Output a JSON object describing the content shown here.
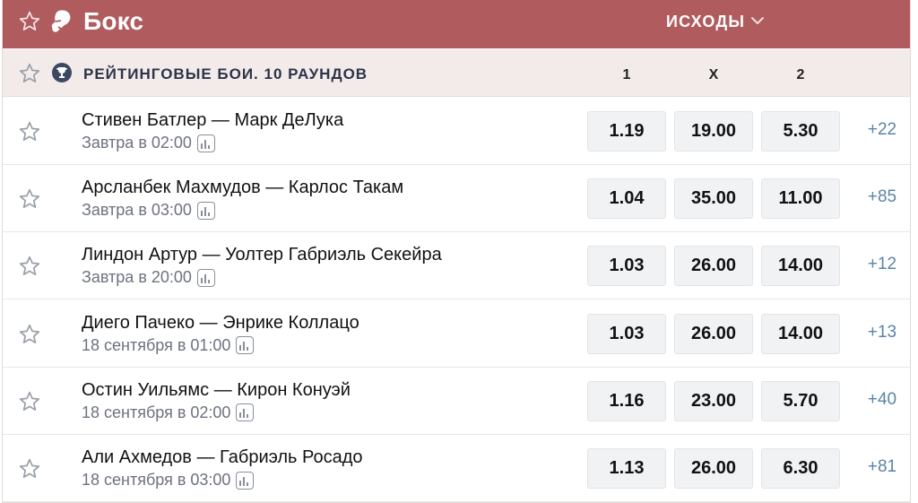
{
  "header": {
    "sport_title": "Бокс",
    "outcomes_label": "исходы",
    "colors": {
      "header_bg": "#b05b5e",
      "subheader_bg": "#f3eaea",
      "more_link": "#5b84a8"
    }
  },
  "league": {
    "name": "Рейтинговые бои. 10 раундов",
    "columns": [
      "1",
      "X",
      "2"
    ]
  },
  "icons": [
    "star-icon",
    "boxing-glove-icon",
    "chevron-down-icon",
    "trophy-icon",
    "stats-icon"
  ],
  "matches": [
    {
      "teams": "Стивен Батлер — Марк ДеЛука",
      "time": "Завтра в 02:00",
      "odds": [
        "1.19",
        "19.00",
        "5.30"
      ],
      "more": "+22"
    },
    {
      "teams": "Арсланбек Махмудов — Карлос Такам",
      "time": "Завтра в 03:00",
      "odds": [
        "1.04",
        "35.00",
        "11.00"
      ],
      "more": "+85"
    },
    {
      "teams": "Линдон Артур — Уолтер Габриэль Секейра",
      "time": "Завтра в 20:00",
      "odds": [
        "1.03",
        "26.00",
        "14.00"
      ],
      "more": "+12"
    },
    {
      "teams": "Диего Пачеко — Энрике Коллацо",
      "time": "18 сентября в 01:00",
      "odds": [
        "1.03",
        "26.00",
        "14.00"
      ],
      "more": "+13"
    },
    {
      "teams": "Остин Уильямс — Кирон Конуэй",
      "time": "18 сентября в 02:00",
      "odds": [
        "1.16",
        "23.00",
        "5.70"
      ],
      "more": "+40"
    },
    {
      "teams": "Али Ахмедов — Габриэль Росадо",
      "time": "18 сентября в 03:00",
      "odds": [
        "1.13",
        "26.00",
        "6.30"
      ],
      "more": "+81"
    }
  ]
}
